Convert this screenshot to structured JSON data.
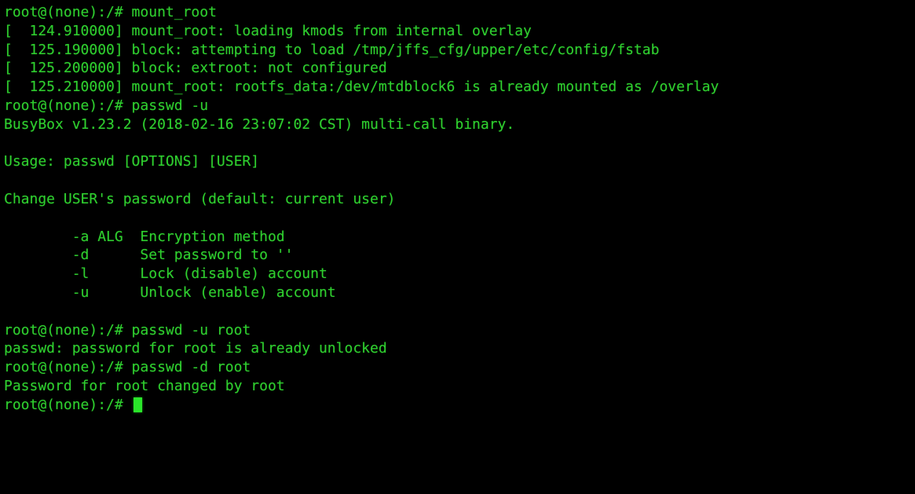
{
  "terminal": {
    "shell": "BusyBox ash",
    "background_color": "#000000",
    "foreground_color": "#2fcf2f",
    "cursor_color": "#2ae62a",
    "columns": 92,
    "rows": 26,
    "prompt": "root@(none):/# ",
    "lines": [
      "root@(none):/# mount_root",
      "[  124.910000] mount_root: loading kmods from internal overlay",
      "[  125.190000] block: attempting to load /tmp/jffs_cfg/upper/etc/config/fstab",
      "[  125.200000] block: extroot: not configured",
      "[  125.210000] mount_root: rootfs_data:/dev/mtdblock6 is already mounted as /overlay",
      "root@(none):/# passwd -u",
      "BusyBox v1.23.2 (2018-02-16 23:07:02 CST) multi-call binary.",
      "",
      "Usage: passwd [OPTIONS] [USER]",
      "",
      "Change USER's password (default: current user)",
      "",
      "        -a ALG  Encryption method",
      "        -d      Set password to ''",
      "        -l      Lock (disable) account",
      "        -u      Unlock (enable) account",
      "",
      "root@(none):/# passwd -u root",
      "passwd: password for root is already unlocked",
      "root@(none):/# passwd -d root",
      "Password for root changed by root"
    ],
    "final_prompt": "root@(none):/# ",
    "cursor_glyph": "block-cursor",
    "commands_entered": [
      "mount_root",
      "passwd -u",
      "passwd -u root",
      "passwd -d root"
    ],
    "busybox": {
      "name": "BusyBox",
      "version": "v1.23.2",
      "build_date": "2018-02-16",
      "build_time": "23:07:02",
      "timezone": "CST",
      "binary_type": "multi-call binary."
    },
    "kernel_log": [
      {
        "timestamp": "124.910000",
        "subsystem": "mount_root",
        "message": "loading kmods from internal overlay"
      },
      {
        "timestamp": "125.190000",
        "subsystem": "block",
        "message": "attempting to load /tmp/jffs_cfg/upper/etc/config/fstab"
      },
      {
        "timestamp": "125.200000",
        "subsystem": "block",
        "message": "extroot: not configured"
      },
      {
        "timestamp": "125.210000",
        "subsystem": "mount_root",
        "message": "rootfs_data:/dev/mtdblock6 is already mounted as /overlay"
      }
    ],
    "passwd_usage": {
      "usage_line": "Usage: passwd [OPTIONS] [USER]",
      "description": "Change USER's password (default: current user)",
      "options": [
        {
          "flag": "-a ALG",
          "description": "Encryption method"
        },
        {
          "flag": "-d",
          "description": "Set password to ''"
        },
        {
          "flag": "-l",
          "description": "Lock (disable) account"
        },
        {
          "flag": "-u",
          "description": "Unlock (enable) account"
        }
      ]
    },
    "results": [
      "passwd: password for root is already unlocked",
      "Password for root changed by root"
    ]
  }
}
